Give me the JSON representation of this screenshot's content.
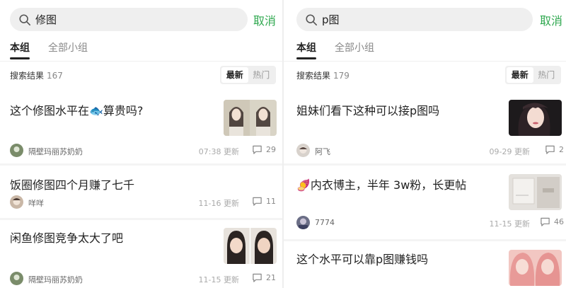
{
  "panels": [
    {
      "search_query": "修图",
      "cancel_label": "取消",
      "tabs": [
        {
          "label": "本组"
        },
        {
          "label": "全部小组"
        }
      ],
      "results_label": "搜索结果",
      "results_count": "167",
      "sort": {
        "latest": "最新",
        "hot": "热门"
      },
      "posts": [
        {
          "title": "这个修图水平在🐟算贵吗?",
          "author": "隔壁玛丽苏奶奶",
          "time": "07:38 更新",
          "comments": "29",
          "has_thumb": true
        },
        {
          "title": "饭圈修图四个月赚了七千",
          "author": "咩咩",
          "time": "11-16 更新",
          "comments": "11",
          "has_thumb": false
        },
        {
          "title": "闲鱼修图竞争太大了吧",
          "author": "隔壁玛丽苏奶奶",
          "time": "11-15 更新",
          "comments": "21",
          "has_thumb": true
        }
      ]
    },
    {
      "search_query": "p图",
      "cancel_label": "取消",
      "tabs": [
        {
          "label": "本组"
        },
        {
          "label": "全部小组"
        }
      ],
      "results_label": "搜索结果",
      "results_count": "179",
      "sort": {
        "latest": "最新",
        "hot": "热门"
      },
      "posts": [
        {
          "title": "姐妹们看下这种可以接p图吗",
          "author": "阿飞",
          "time": "09-29 更新",
          "comments": "2",
          "has_thumb": true
        },
        {
          "title": "🍠内衣博主，半年 3w粉，长更帖",
          "author": "7774",
          "time": "11-15 更新",
          "comments": "46",
          "has_thumb": true
        },
        {
          "title": "这个水平可以靠p图赚钱吗",
          "author": "",
          "time": "",
          "comments": "",
          "has_thumb": true
        }
      ]
    }
  ],
  "colors": {
    "accent": "#2fa84f",
    "search_bg": "#efefef",
    "text": "#222222",
    "muted": "#999999"
  },
  "icons": {
    "search": "search-icon",
    "comment": "comment-icon"
  }
}
